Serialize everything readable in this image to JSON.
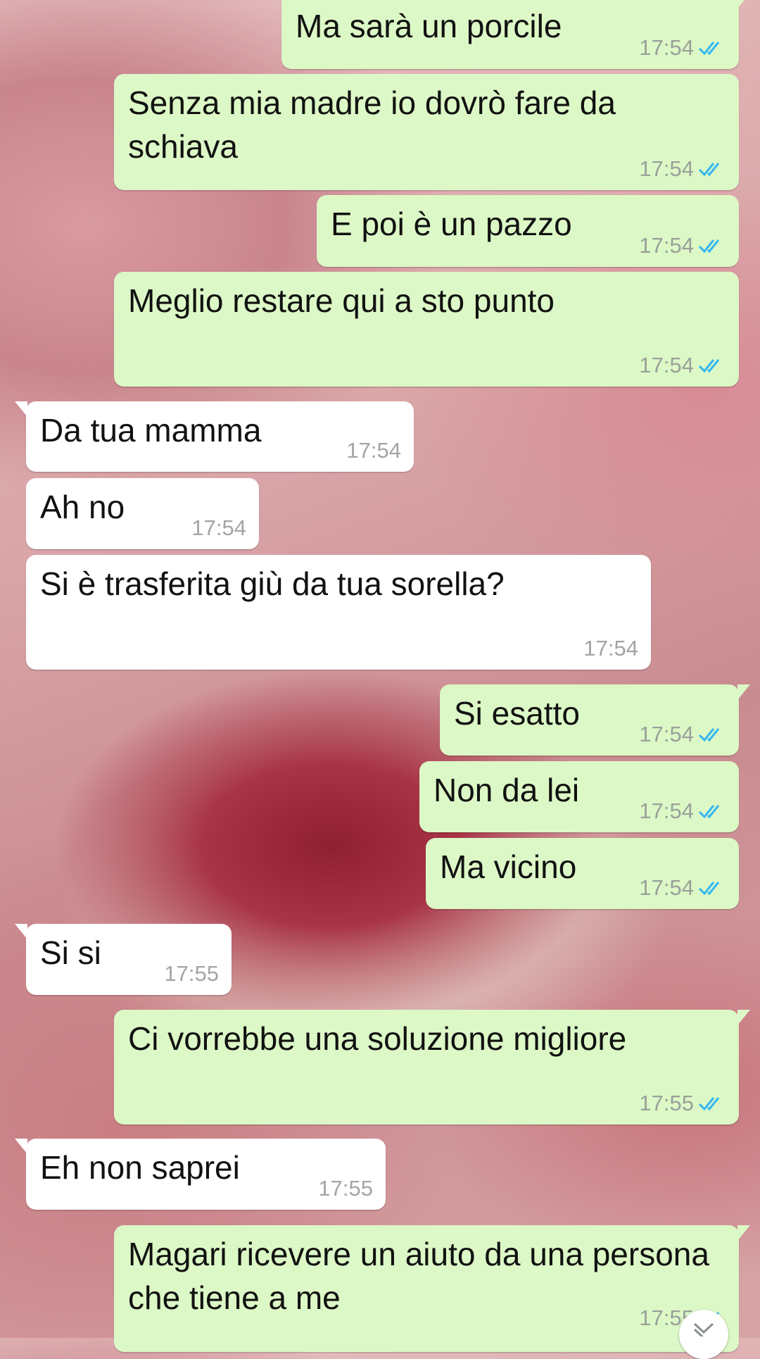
{
  "messages": [
    {
      "text": "Ma sarà un porcile",
      "time": "17:54",
      "read": true
    },
    {
      "text": "Senza mia madre io dovrò fare da schiava",
      "time": "17:54",
      "read": true
    },
    {
      "text": "E poi è un pazzo",
      "time": "17:54",
      "read": true
    },
    {
      "text": "Meglio restare qui a sto punto",
      "time": "17:54",
      "read": true
    },
    {
      "text": "Da tua mamma",
      "time": "17:54"
    },
    {
      "text": "Ah no",
      "time": "17:54"
    },
    {
      "text": "Si è trasferita giù da tua sorella?",
      "time": "17:54"
    },
    {
      "text": "Si esatto",
      "time": "17:54",
      "read": true
    },
    {
      "text": "Non da lei",
      "time": "17:54",
      "read": true
    },
    {
      "text": "Ma vicino",
      "time": "17:54",
      "read": true
    },
    {
      "text": "Si si",
      "time": "17:55"
    },
    {
      "text": "Ci vorrebbe una soluzione migliore",
      "time": "17:55",
      "read": true
    },
    {
      "text": "Eh non saprei",
      "time": "17:55"
    },
    {
      "text": "Magari ricevere un aiuto da una persona che tiene a me",
      "time": "17:55",
      "read": true
    }
  ],
  "icons": {
    "read_receipt": "double-check-icon",
    "scroll_down": "chevron-down-icon"
  },
  "colors": {
    "outgoing_bubble": "#dcf8c6",
    "incoming_bubble": "#ffffff",
    "read_tick": "#34b7f1"
  }
}
